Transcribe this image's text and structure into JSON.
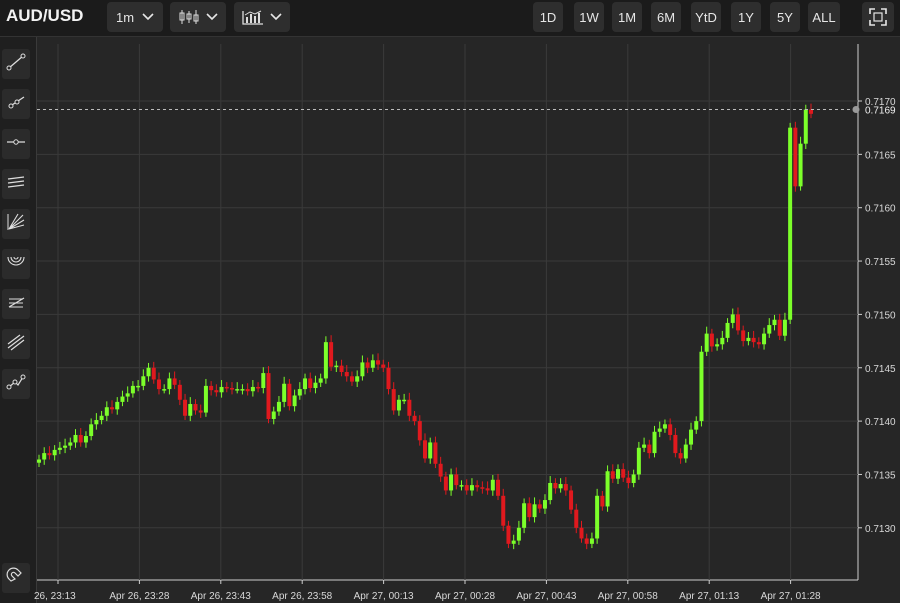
{
  "header": {
    "symbol": "AUD/USD",
    "interval": "1m",
    "ranges": [
      "1D",
      "1W",
      "1M",
      "6M",
      "YtD",
      "1Y",
      "5Y",
      "ALL"
    ]
  },
  "icons": {
    "interval_dropdown": "chevron-down-icon",
    "candle_type": "candlestick-icon",
    "indicators": "indicators-chart-icon",
    "fullscreen": "fullscreen-icon",
    "tools": [
      "trend-line-icon",
      "ray-icon",
      "horizontal-line-icon",
      "parallel-channel-icon",
      "fib-fan-icon",
      "arc-icon",
      "fib-retracement-icon",
      "pitchfork-icon",
      "path-icon",
      "magnet-icon"
    ]
  },
  "colors": {
    "background": "#262626",
    "up": "#7cff2a",
    "down": "#e0191e",
    "grid": "#3a3a3a",
    "axis_text": "#d8d8d8"
  },
  "chart_data": {
    "type": "candlestick",
    "title": "",
    "xlabel": "",
    "ylabel": "",
    "ylim": [
      0.71255,
      0.71727
    ],
    "grid": true,
    "x_tick_labels": [
      "26, 23:13",
      "Apr 26, 23:28",
      "Apr 26, 23:43",
      "Apr 26, 23:58",
      "Apr 27, 00:13",
      "Apr 27, 00:28",
      "Apr 27, 00:43",
      "Apr 27, 00:58",
      "Apr 27, 01:13",
      "Apr 27, 01:28"
    ],
    "y_tick_labels": [
      "0.7130",
      "0.7135",
      "0.7140",
      "0.7145",
      "0.7150",
      "0.7155",
      "0.7160",
      "0.7165",
      "0.7170"
    ],
    "last_price_label": "0.7169",
    "crosshair_price": 0.71692,
    "closes": [
      0.71364,
      0.7137,
      0.71368,
      0.71373,
      0.71375,
      0.71377,
      0.7138,
      0.71387,
      0.7138,
      0.71386,
      0.71397,
      0.71401,
      0.71405,
      0.71413,
      0.71411,
      0.71418,
      0.71423,
      0.71426,
      0.71433,
      0.71433,
      0.71442,
      0.7145,
      0.71439,
      0.7143,
      0.7143,
      0.7144,
      0.71434,
      0.7142,
      0.71405,
      0.71416,
      0.7141,
      0.71408,
      0.71433,
      0.71429,
      0.71427,
      0.71432,
      0.71431,
      0.7143,
      0.7143,
      0.7143,
      0.71428,
      0.71432,
      0.71431,
      0.71445,
      0.71402,
      0.71409,
      0.71418,
      0.71435,
      0.71414,
      0.71424,
      0.7143,
      0.7144,
      0.71431,
      0.71436,
      0.7144,
      0.71474,
      0.71451,
      0.71452,
      0.71446,
      0.71442,
      0.71437,
      0.71442,
      0.71455,
      0.7145,
      0.71457,
      0.71453,
      0.7145,
      0.7143,
      0.7141,
      0.7142,
      0.7142,
      0.71405,
      0.714,
      0.71382,
      0.71365,
      0.7138,
      0.7136,
      0.71348,
      0.71335,
      0.7135,
      0.7134,
      0.7134,
      0.71335,
      0.7134,
      0.71338,
      0.71337,
      0.71335,
      0.71345,
      0.7133,
      0.71302,
      0.71285,
      0.71288,
      0.713,
      0.71323,
      0.7131,
      0.71322,
      0.71318,
      0.71326,
      0.71342,
      0.71337,
      0.71341,
      0.71335,
      0.71317,
      0.713,
      0.7129,
      0.71285,
      0.7129,
      0.7133,
      0.7132,
      0.71353,
      0.71346,
      0.71355,
      0.71347,
      0.71342,
      0.7135,
      0.71375,
      0.71378,
      0.7137,
      0.7139,
      0.71393,
      0.71397,
      0.71387,
      0.7137,
      0.71365,
      0.71378,
      0.71392,
      0.714,
      0.71465,
      0.71482,
      0.7147,
      0.71472,
      0.71478,
      0.71492,
      0.715,
      0.71485,
      0.71475,
      0.71478,
      0.71474,
      0.71472,
      0.71482,
      0.7149,
      0.71495,
      0.7148,
      0.71495,
      0.71675,
      0.7162,
      0.7166,
      0.71692,
      0.71688
    ]
  }
}
